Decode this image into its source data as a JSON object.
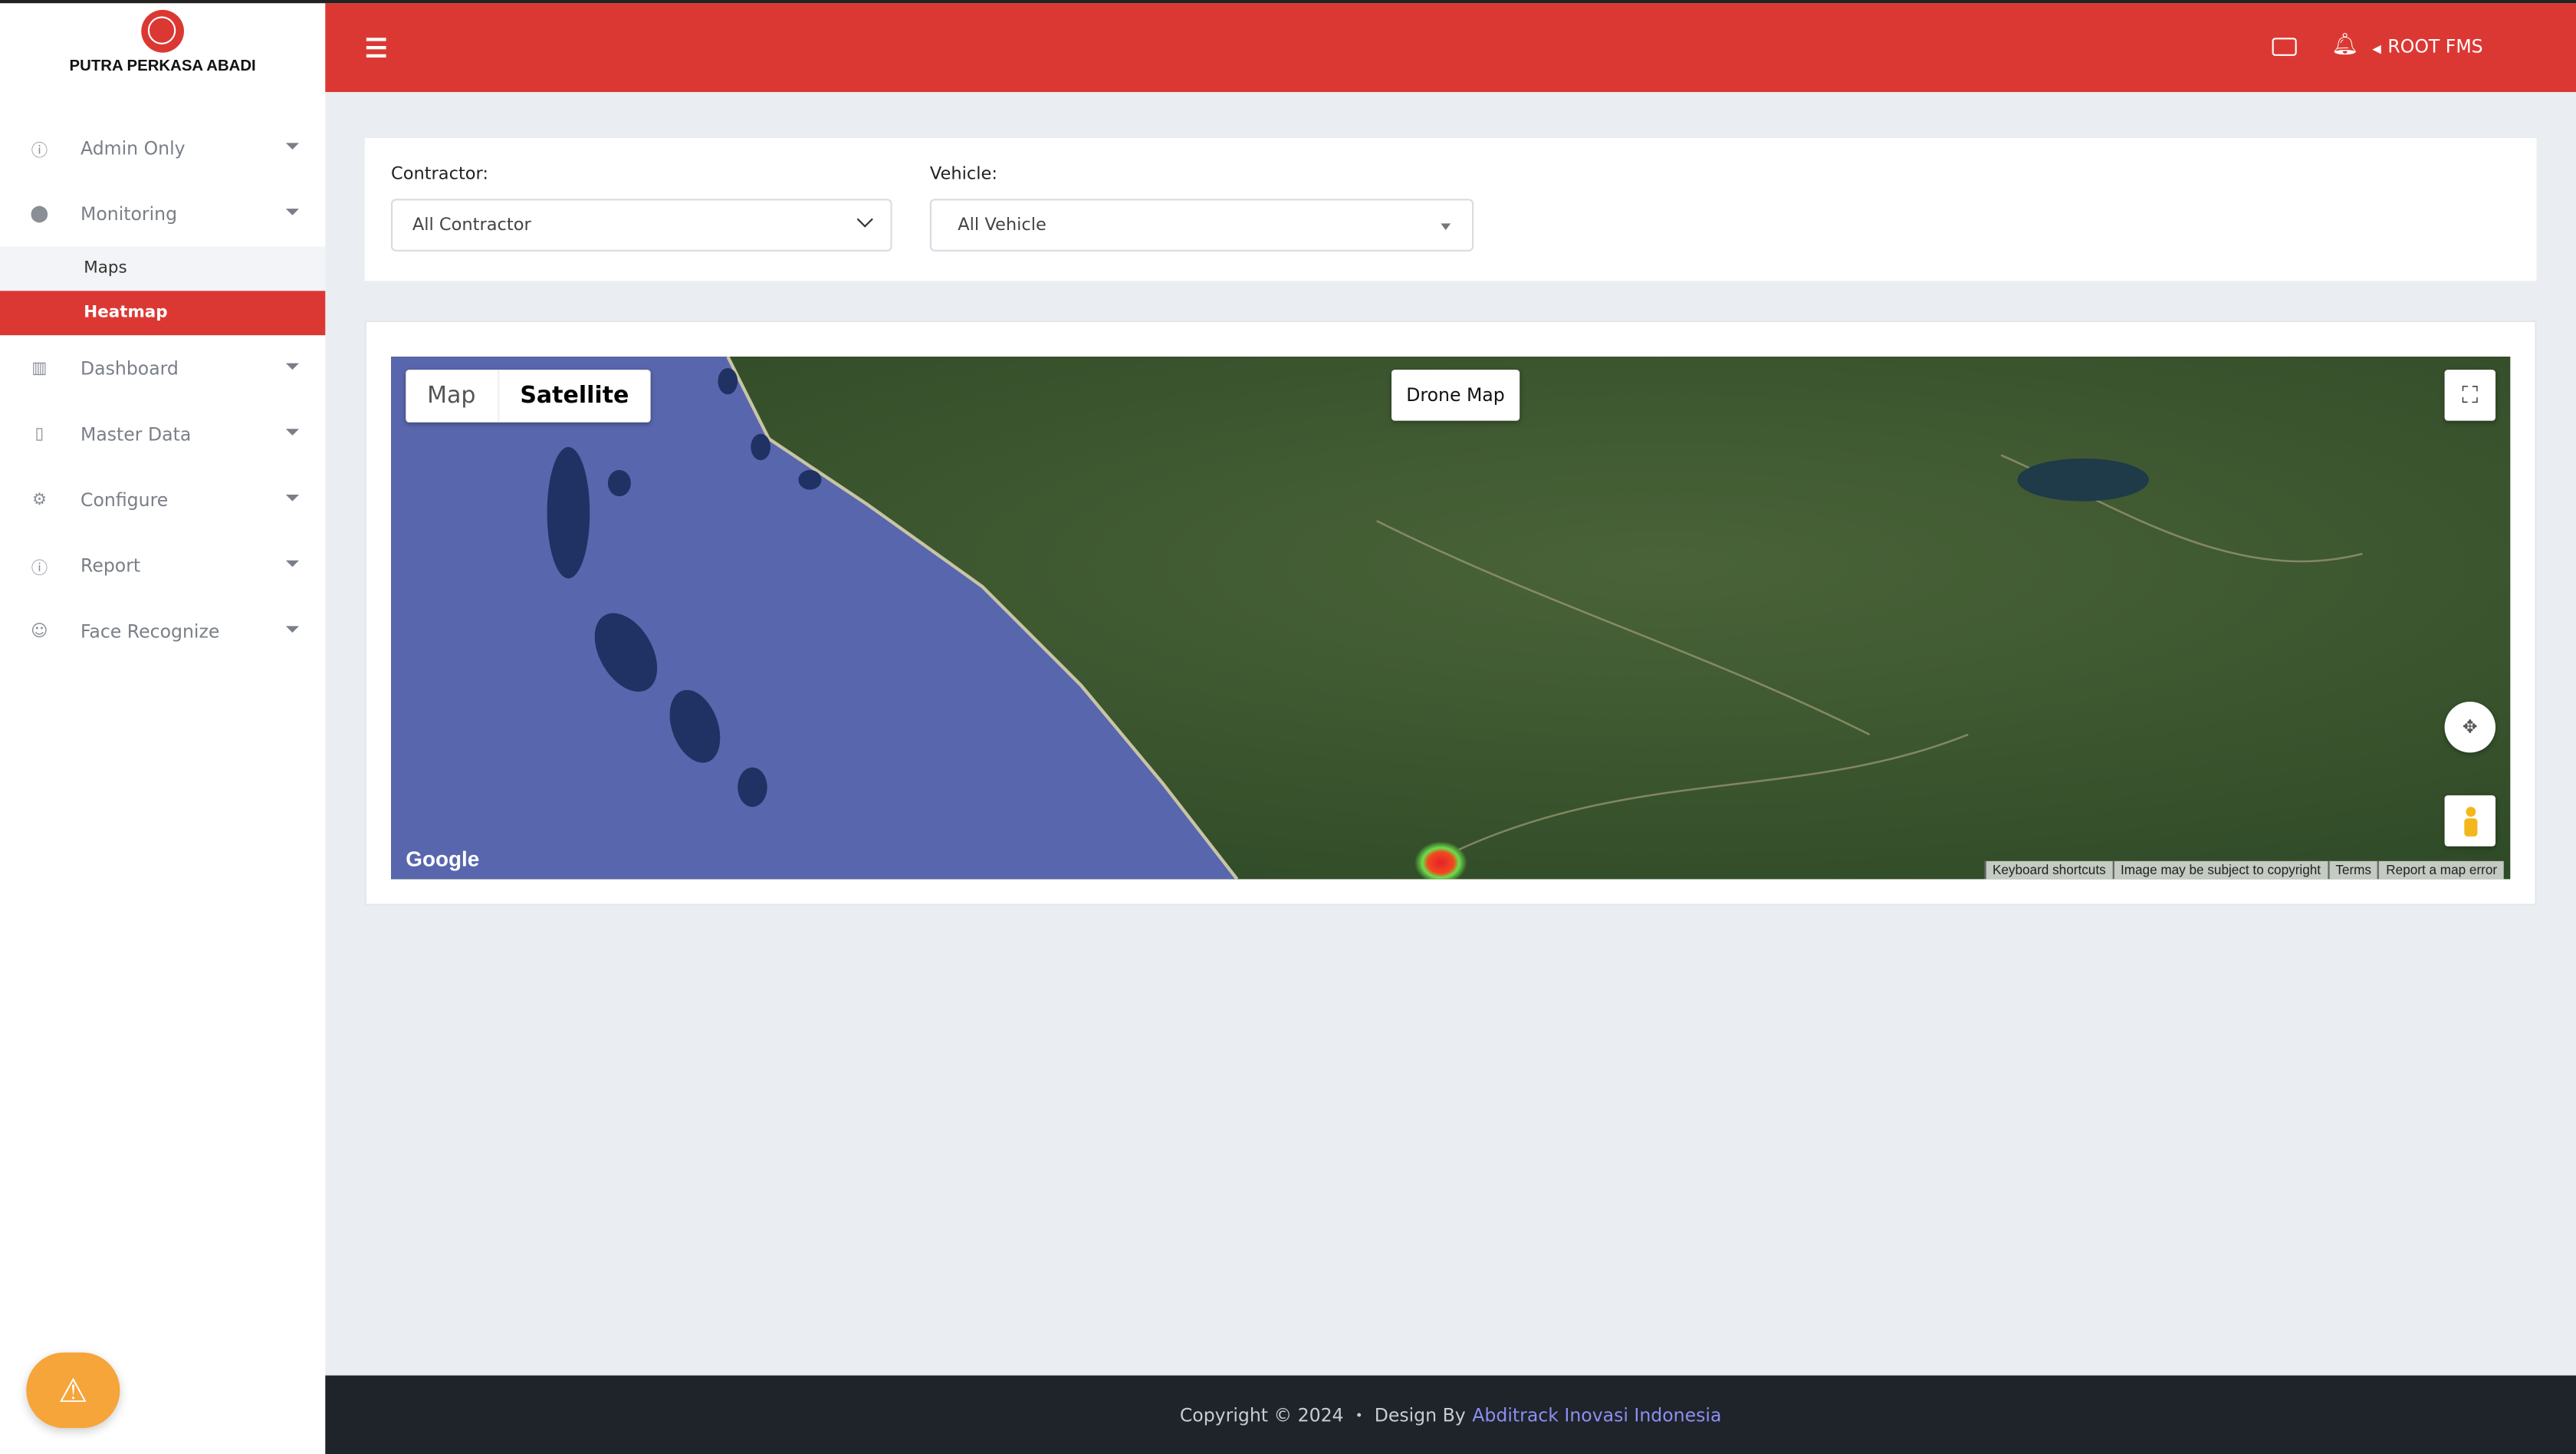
{
  "brand": {
    "name": "PUTRA PERKASA ABADI"
  },
  "colors": {
    "primary": "#dc3833",
    "footer_bg": "#1f232a",
    "link": "#8b8ff0",
    "warning": "#f5a53a"
  },
  "sidebar": {
    "items": [
      {
        "label": "Admin Only",
        "icon": "info-icon"
      },
      {
        "label": "Monitoring",
        "icon": "map-pin-icon"
      },
      {
        "label": "Dashboard",
        "icon": "columns-icon"
      },
      {
        "label": "Master Data",
        "icon": "file-icon"
      },
      {
        "label": "Configure",
        "icon": "gear-icon"
      },
      {
        "label": "Report",
        "icon": "info-icon"
      },
      {
        "label": "Face Recognize",
        "icon": "face-scan-icon"
      }
    ],
    "monitoring_sub": [
      {
        "label": "Maps",
        "active": false
      },
      {
        "label": "Heatmap",
        "active": true
      }
    ]
  },
  "header": {
    "user": "ROOT FMS"
  },
  "filters": {
    "contractor": {
      "label": "Contractor:",
      "value": "All Contractor"
    },
    "vehicle": {
      "label": "Vehicle:",
      "value": "All Vehicle"
    }
  },
  "map": {
    "type_map": "Map",
    "type_satellite": "Satellite",
    "selected_type": "Satellite",
    "drone_button": "Drone Map",
    "google_logo": "Google",
    "attribution": [
      "Keyboard shortcuts",
      "Image may be subject to copyright",
      "Terms",
      "Report a map error"
    ]
  },
  "footer": {
    "copyright": "Copyright © 2024",
    "sep": "•",
    "design_by": "Design By",
    "company": "Abditrack Inovasi Indonesia"
  }
}
